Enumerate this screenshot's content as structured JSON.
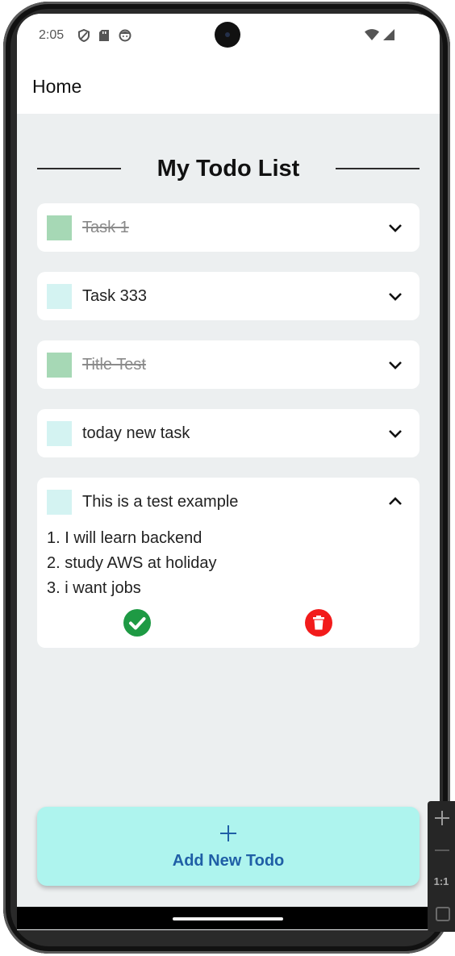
{
  "status_bar": {
    "time": "2:05",
    "icons": [
      "shield-icon",
      "sd-card-icon",
      "face-icon"
    ],
    "right_icons": [
      "wifi-icon",
      "signal-icon"
    ]
  },
  "app_bar": {
    "title": "Home"
  },
  "list": {
    "heading": "My Todo List",
    "items": [
      {
        "title": "Task 1",
        "completed": true,
        "expanded": false
      },
      {
        "title": "Task 333",
        "completed": false,
        "expanded": false
      },
      {
        "title": "Title Test",
        "completed": true,
        "expanded": false
      },
      {
        "title": "today new task",
        "completed": false,
        "expanded": false
      },
      {
        "title": "This is a test example",
        "completed": false,
        "expanded": true,
        "description": [
          "1. I will learn backend",
          "2. study AWS at holiday",
          "3. i want jobs"
        ],
        "actions": [
          "check-circle-icon",
          "trash-icon"
        ]
      }
    ]
  },
  "add_button": {
    "label": "Add New Todo",
    "icon": "plus-icon"
  },
  "emulator_toolbar": {
    "ratio_label": "1:1"
  },
  "colors": {
    "background": "#eceff0",
    "card": "#ffffff",
    "checkbox_done": "#a6d8b5",
    "checkbox_open": "#d4f3f2",
    "add_button": "#aef4ee",
    "add_label": "#1f5fa6",
    "complete": "#1e9a44",
    "delete": "#f21b1b"
  }
}
